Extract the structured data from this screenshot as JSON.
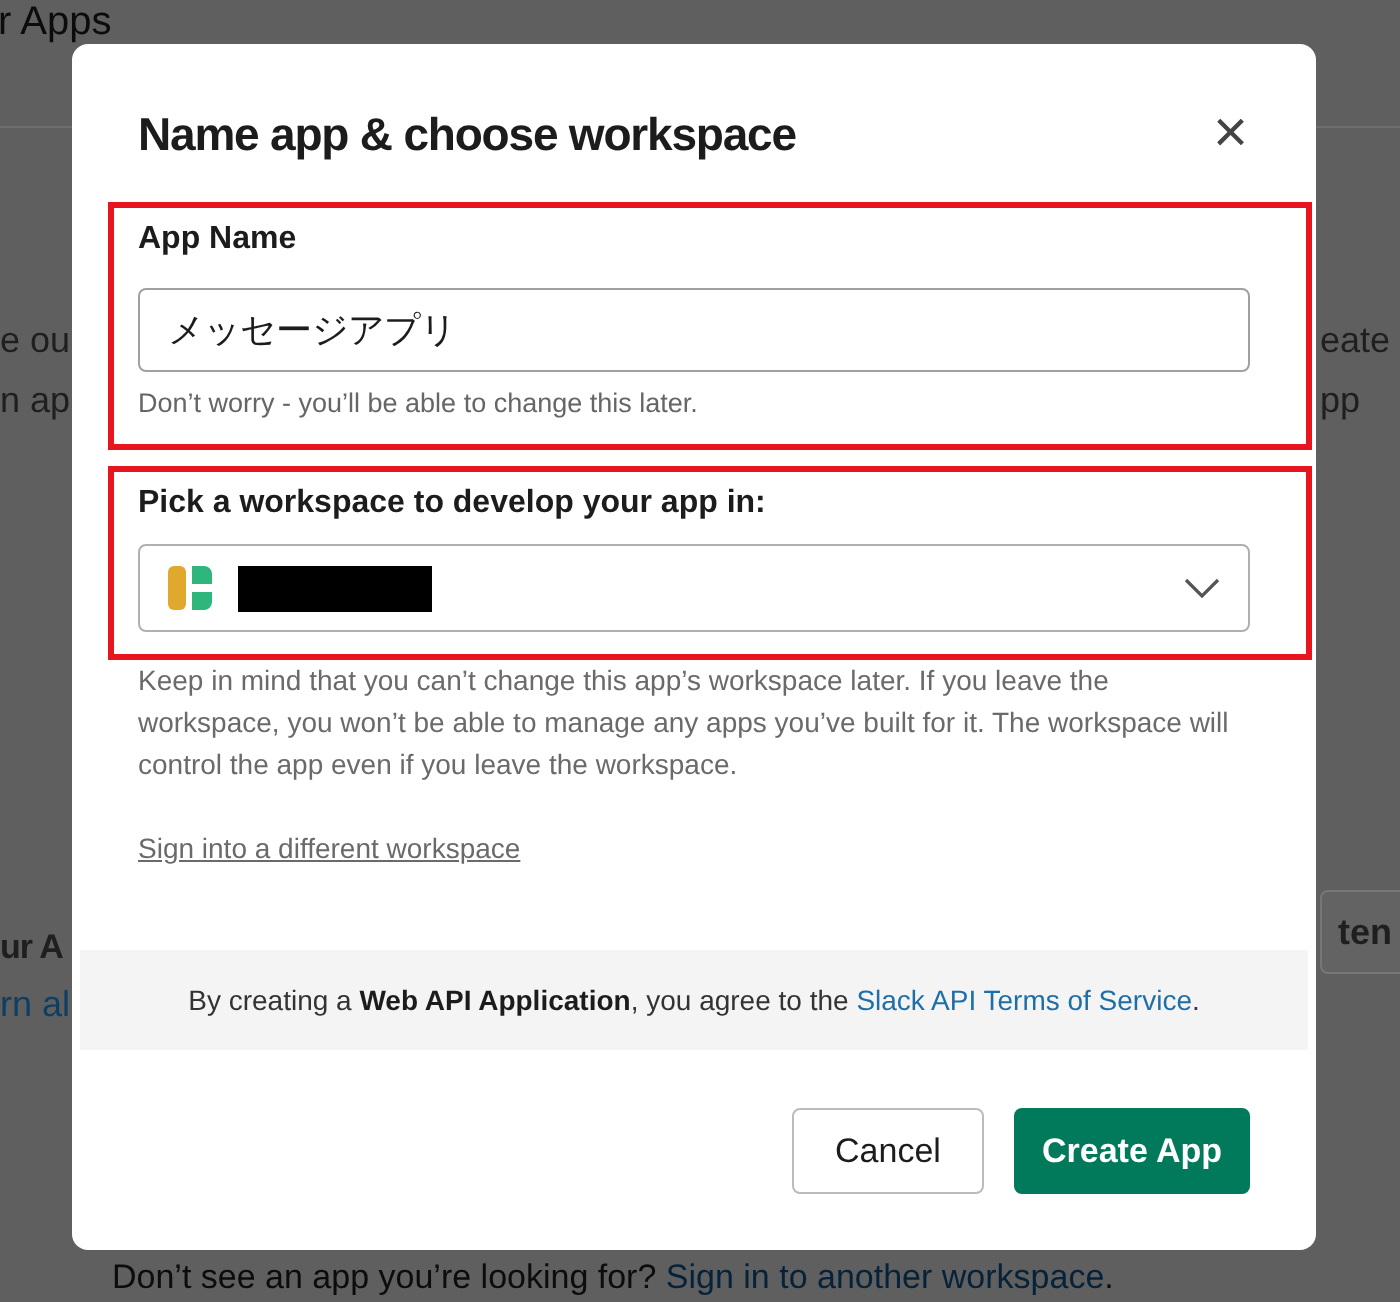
{
  "background_page": {
    "heading": "r Apps",
    "left_texts": [
      {
        "text": "e ou",
        "kind": "body"
      },
      {
        "text": "n ap",
        "kind": "body"
      },
      {
        "text": "ur A",
        "kind": "heading"
      },
      {
        "text": "rn al",
        "kind": "link"
      }
    ],
    "right_texts": [
      {
        "text": "eate",
        "kind": "body"
      },
      {
        "text": "pp",
        "kind": "body"
      },
      {
        "text": "ten",
        "kind": "button"
      }
    ],
    "footer": {
      "text": "Don’t see an app you’re looking for? ",
      "link": "Sign in to another workspace",
      "end": "."
    }
  },
  "modal": {
    "title": "Name app & choose workspace",
    "close": "×",
    "sections": [
      {
        "kind": "text_input",
        "label": "App Name",
        "value": "メッセージアプリ",
        "hint": "Don’t worry - you’ll be able to change this later.",
        "highlighted": true
      },
      {
        "kind": "select",
        "label": "Pick a workspace to develop your app in:",
        "redacted": true,
        "highlighted": true
      }
    ],
    "note": "Keep in mind that you can’t change this app’s workspace later. If you leave the workspace, you won’t be able to manage any apps you’ve built for it. The workspace will control the app even if you leave the workspace.",
    "link": "Sign into a different workspace",
    "terms": {
      "text": "By creating a **Web API Application**, you agree to the ",
      "link": "Slack API Terms of Service",
      "end": "."
    },
    "buttons": [
      {
        "label": "Cancel",
        "kind": "secondary"
      },
      {
        "label": "Create App",
        "kind": "primary"
      }
    ]
  }
}
